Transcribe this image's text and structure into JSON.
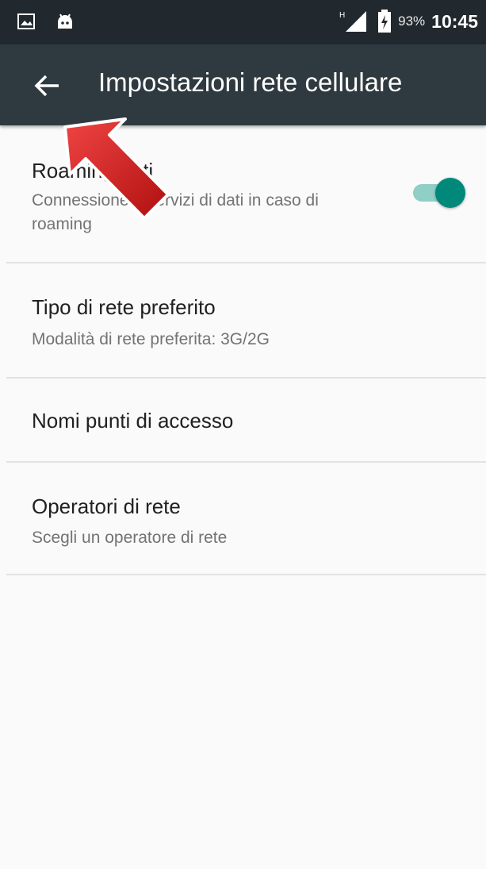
{
  "status_bar": {
    "battery_percent": "93%",
    "time": "10:45",
    "network_label": "H",
    "icons": [
      "gallery-icon",
      "android-icon",
      "signal-icon",
      "battery-charging-icon"
    ]
  },
  "app_bar": {
    "title": "Impostazioni rete cellulare",
    "back_icon": "arrow-back-icon"
  },
  "settings": [
    {
      "title": "Roaming dati",
      "subtitle": "Connessione a servizi di dati in caso di roaming",
      "toggle_on": true
    },
    {
      "title": "Tipo di rete preferito",
      "subtitle": "Modalità di rete preferita: 3G/2G"
    },
    {
      "title": "Nomi punti di accesso",
      "subtitle": ""
    },
    {
      "title": "Operatori di rete",
      "subtitle": "Scegli un operatore di rete"
    }
  ],
  "colors": {
    "status_bar": "#22292e",
    "app_bar": "#2f3a40",
    "accent": "#00897b",
    "annotation_arrow": "#d01919"
  }
}
